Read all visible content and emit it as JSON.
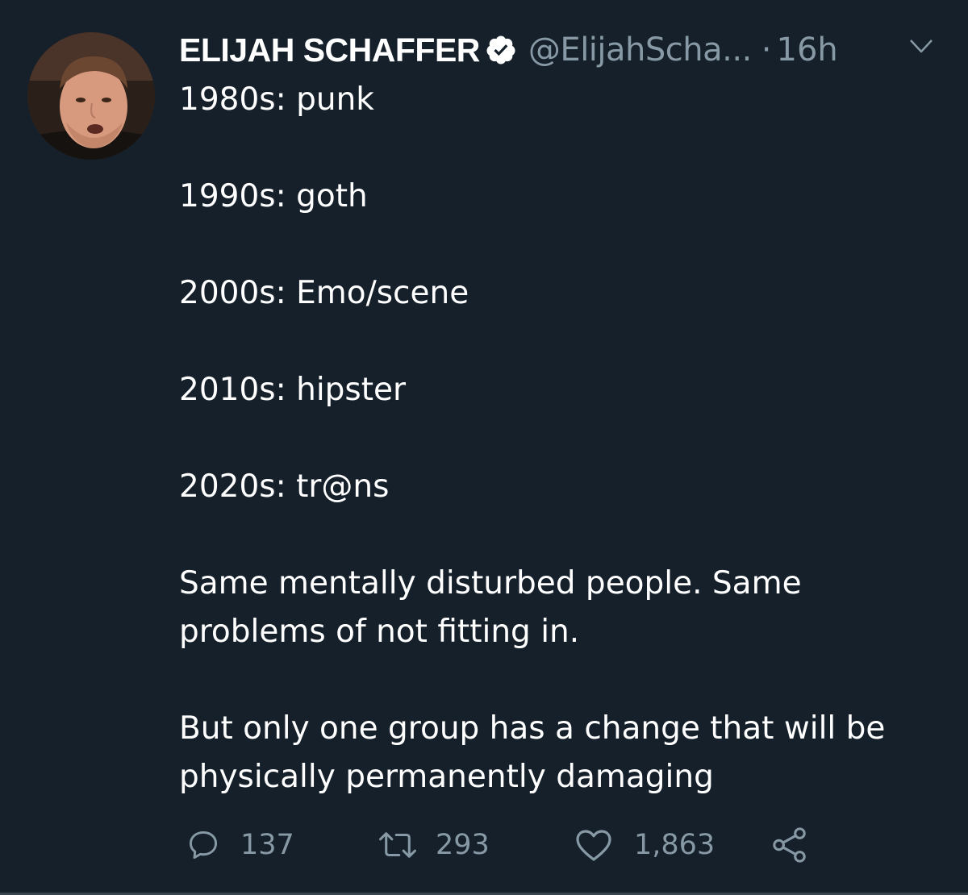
{
  "tweet": {
    "author": {
      "display_name": "ELIJAH SCHAFFER",
      "handle": "@ElijahScha...",
      "verified": true
    },
    "separator": "·",
    "time": "16h",
    "lines": [
      "1980s: punk",
      "1990s: goth",
      "2000s: Emo/scene",
      "2010s: hipster",
      "2020s: tr@ns",
      "Same mentally disturbed people. Same problems of not fitting in.",
      "But only one group has a change that will be physically permanently damaging"
    ],
    "actions": {
      "replies": "137",
      "retweets": "293",
      "likes": "1,863"
    }
  },
  "icons": {
    "verified": "verified-badge-icon",
    "caret": "chevron-down-icon",
    "reply": "reply-icon",
    "retweet": "retweet-icon",
    "like": "heart-icon",
    "share": "share-icon"
  },
  "colors": {
    "background": "#15202b",
    "primary_text": "#ffffff",
    "secondary_text": "#8899a6"
  }
}
